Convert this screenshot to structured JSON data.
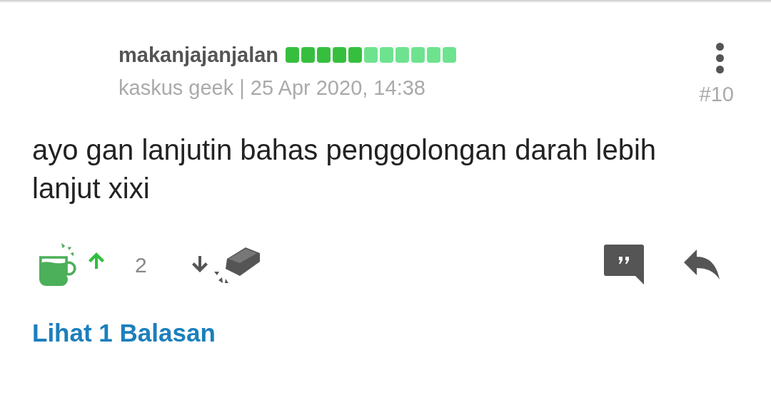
{
  "post": {
    "username": "makanjajanjalan",
    "reputation": {
      "segments": [
        {
          "filled": true
        },
        {
          "filled": true
        },
        {
          "filled": true
        },
        {
          "filled": true
        },
        {
          "filled": true
        },
        {
          "filled": false
        },
        {
          "filled": false
        },
        {
          "filled": false
        },
        {
          "filled": false
        },
        {
          "filled": false
        },
        {
          "filled": false
        }
      ]
    },
    "meta": "kaskus geek | 25 Apr 2020, 14:38",
    "number": "#10",
    "body": "ayo gan lanjutin bahas penggolongan darah lebih lanjut xixi",
    "vote": {
      "upvoted": true,
      "count": "2"
    },
    "replies_link": "Lihat 1 Balasan"
  }
}
